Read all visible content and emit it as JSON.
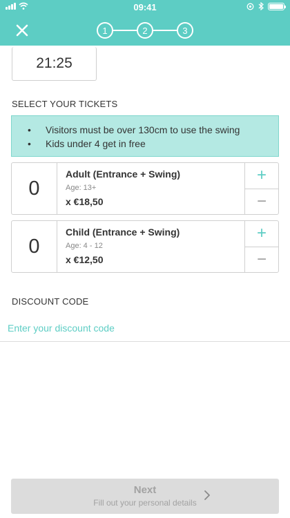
{
  "status_bar": {
    "time": "09:41"
  },
  "header": {
    "steps": [
      "1",
      "2",
      "3"
    ]
  },
  "time_selector": {
    "value": "21:25"
  },
  "tickets_section": {
    "title": "SELECT YOUR TICKETS",
    "notes": [
      "Visitors must be over 130cm to use the swing",
      "Kids under 4 get in free"
    ],
    "items": [
      {
        "quantity": "0",
        "name": "Adult (Entrance + Swing)",
        "age": "Age: 13+",
        "price": "x €18,50",
        "plus": "+",
        "minus": "−"
      },
      {
        "quantity": "0",
        "name": "Child (Entrance + Swing)",
        "age": "Age: 4 - 12",
        "price": "x €12,50",
        "plus": "+",
        "minus": "−"
      }
    ]
  },
  "discount": {
    "title": "DISCOUNT CODE",
    "placeholder": "Enter your discount code",
    "value": ""
  },
  "footer": {
    "next_label": "Next",
    "next_sub": "Fill out your personal details"
  },
  "colors": {
    "accent": "#5dcdc4",
    "info_bg": "#b4e9e3",
    "disabled": "#dcdcdc"
  }
}
